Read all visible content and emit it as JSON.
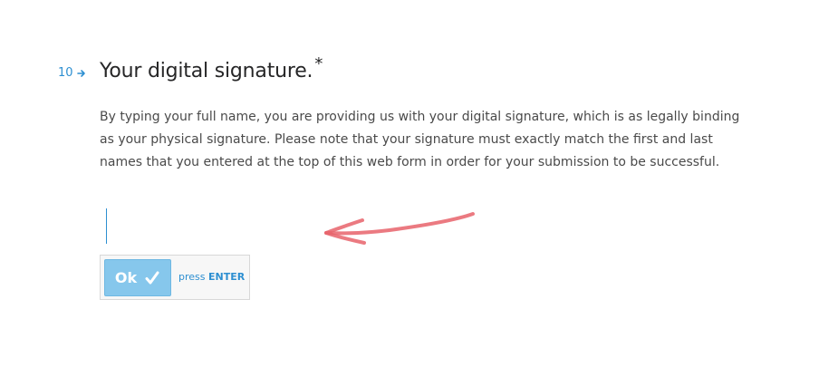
{
  "question": {
    "number": "10",
    "title": "Your digital signature.",
    "required_mark": "*",
    "description": "By typing your full name, you are providing us with your digital signature, which is as legally binding as your physical signature. Please note that your signature must exactly match the first and last names that you entered at the top of this web form in order for your submission to be successful."
  },
  "signature_input": {
    "value": "",
    "placeholder": ""
  },
  "ok_button": {
    "label": "Ok"
  },
  "hint": {
    "press": "press",
    "key": "ENTER"
  },
  "colors": {
    "accent": "#2d8fd1",
    "ok_button_bg": "#86c7ec",
    "annotation_arrow": "#e8636b"
  },
  "icons": {
    "number_arrow": "right-arrow-icon",
    "ok_check": "check-icon",
    "annotation": "hand-drawn-arrow-icon"
  }
}
